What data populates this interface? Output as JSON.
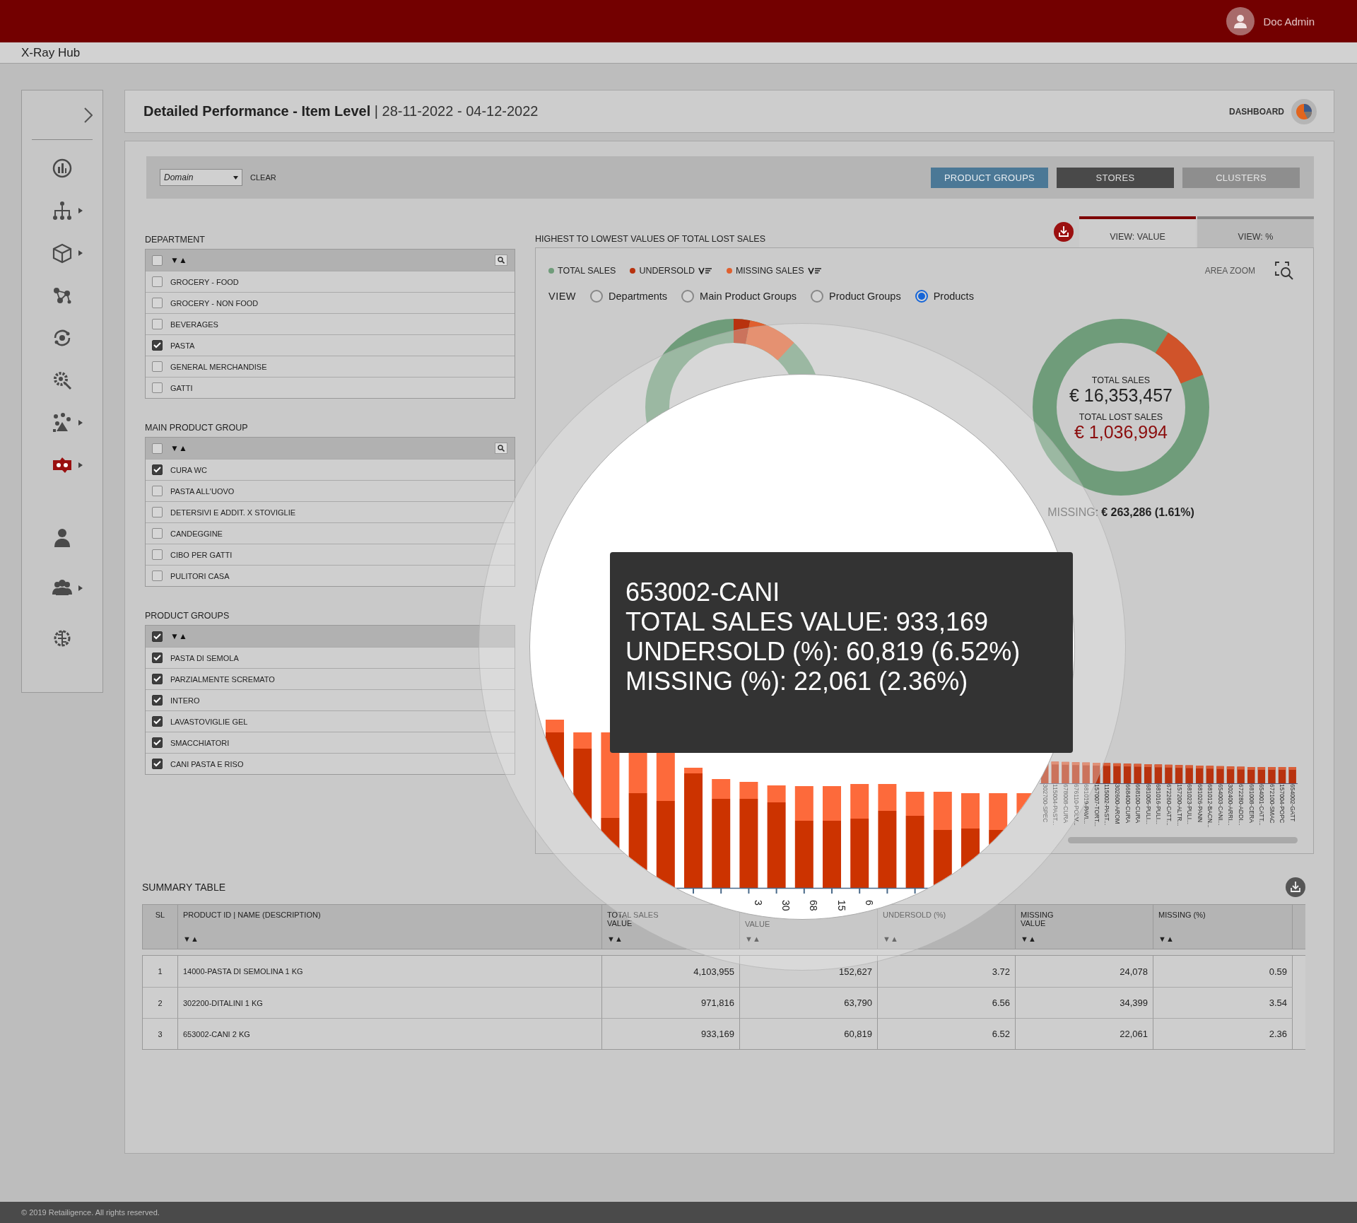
{
  "topbar": {
    "user_name": "Doc Admin"
  },
  "app_title": "X-Ray Hub",
  "sidebar": {
    "sections": [
      {
        "items": [
          {
            "kind": "gauge",
            "has_submenu": false,
            "selected": false
          },
          {
            "kind": "hierarchy",
            "has_submenu": true,
            "selected": false
          },
          {
            "kind": "cube",
            "has_submenu": true,
            "selected": false
          },
          {
            "kind": "molecule",
            "has_submenu": false,
            "selected": false
          },
          {
            "kind": "cycle",
            "has_submenu": false,
            "selected": false
          },
          {
            "kind": "gear",
            "has_submenu": false,
            "selected": false
          },
          {
            "kind": "cluster",
            "has_submenu": true,
            "selected": false
          },
          {
            "kind": "map",
            "has_submenu": true,
            "selected": true
          }
        ]
      },
      {
        "items": [
          {
            "kind": "person",
            "has_submenu": false,
            "selected": false
          },
          {
            "kind": "group",
            "has_submenu": true,
            "selected": false
          },
          {
            "kind": "brain",
            "has_submenu": false,
            "selected": false
          }
        ]
      }
    ]
  },
  "header": {
    "title": "**Detailed Performance - Item Level** | 28-11-2022 - 04-12-2022",
    "link": "DASHBOARD"
  },
  "filter_bar": {
    "domain_select": "Domain",
    "clear": "CLEAR",
    "buttons": [
      {
        "label": "PRODUCT GROUPS",
        "selected": true,
        "disabled": false
      },
      {
        "label": "STORES",
        "selected": false,
        "disabled": false
      },
      {
        "label": "CLUSTERS",
        "selected": false,
        "disabled": true
      }
    ]
  },
  "filters": [
    {
      "title": "DEPARTMENT",
      "header": {
        "checked": false,
        "sort": "▼▲",
        "searchable": true
      },
      "items": [
        {
          "label": "GROCERY - FOOD",
          "checked": false
        },
        {
          "label": "GROCERY - NON FOOD",
          "checked": false
        },
        {
          "label": "BEVERAGES",
          "checked": false
        },
        {
          "label": "PASTA",
          "checked": true
        },
        {
          "label": "GENERAL MERCHANDISE",
          "checked": false
        },
        {
          "label": "GATTI",
          "checked": false
        }
      ]
    },
    {
      "title": "MAIN PRODUCT GROUP",
      "header": {
        "checked": false,
        "sort": "▼▲",
        "searchable": true
      },
      "items": [
        {
          "label": "CURA WC",
          "checked": true
        },
        {
          "label": "PASTA ALL'UOVO",
          "checked": false
        },
        {
          "label": "DETERSIVI E ADDIT. X STOVIGLIE",
          "checked": false
        },
        {
          "label": "CANDEGGINE",
          "checked": false
        },
        {
          "label": "CIBO PER GATTI",
          "checked": false
        },
        {
          "label": "PULITORI CASA",
          "checked": false
        }
      ]
    },
    {
      "title": "PRODUCT GROUPS",
      "header": {
        "checked": true,
        "sort": "▼▲",
        "searchable": false
      },
      "items": [
        {
          "label": "PASTA DI SEMOLA",
          "checked": true
        },
        {
          "label": "PARZIALMENTE SCREMATO",
          "checked": true
        },
        {
          "label": "INTERO",
          "checked": true
        },
        {
          "label": "LAVASTOVIGLIE GEL",
          "checked": true
        },
        {
          "label": "SMACCHIATORI",
          "checked": true
        },
        {
          "label": "CANI PASTA E RISO",
          "checked": true
        }
      ]
    }
  ],
  "chart_panel": {
    "title": "HIGHEST TO LOWEST VALUES OF TOTAL LOST SALES",
    "tabs": [
      {
        "label": "VIEW: VALUE",
        "selected": true
      },
      {
        "label": "VIEW: %",
        "selected": false
      }
    ],
    "legend": [
      {
        "label": "TOTAL SALES",
        "color": "#6f9c7a",
        "has_filter": false
      },
      {
        "label": "UNDERSOLD",
        "color": "#b8320e",
        "has_filter": true
      },
      {
        "label": "MISSING SALES",
        "color": "#e0602f",
        "has_filter": true
      }
    ],
    "area_zoom": "AREA ZOOM",
    "view": {
      "label": "VIEW",
      "options": [
        {
          "label": "Departments",
          "selected": false
        },
        {
          "label": "Main Product Groups",
          "selected": false
        },
        {
          "label": "Product Groups",
          "selected": false
        },
        {
          "label": "Products",
          "selected": true
        }
      ]
    },
    "donut": {
      "total_label": "TOTAL SALES",
      "total_value": "€ 16,353,457",
      "lost_label": "TOTAL LOST SALES",
      "lost_value": "€ 1,036,994",
      "missing_label": "MISSING:",
      "missing_value": "€ 263,286 (1.61%)"
    },
    "bar_labels": [
      "302700-SPEC",
      "115004-PAST...",
      "678008-CURA",
      "676110-POLV...",
      "681019-PAVI...",
      "157007-TORT...",
      "115002-PAST...",
      "302600-AROM",
      "668400-CURA",
      "668100-CURA",
      "681005-PULI...",
      "681016-PULI...",
      "672260-CATT...",
      "157200-ALTR...",
      "681023-PULI...",
      "681026-PANN",
      "681012-BACN...",
      "654003-CANI...",
      "302400-ARRI...",
      "672280-ADDI...",
      "681008-CERA",
      "654001-CATT...",
      "672100-SMAC",
      "157004-POPC",
      "654002-GATT"
    ]
  },
  "magnifier": {
    "axis_fragments": [
      "3",
      "30",
      "68",
      "15",
      "6"
    ],
    "tooltip": [
      "653002-CANI",
      "TOTAL SALES VALUE: 933,169",
      "UNDERSOLD (%): 60,819 (6.52%)",
      "MISSING (%): 22,061 (2.36%)"
    ]
  },
  "summary": {
    "title": "SUMMARY TABLE",
    "columns": [
      {
        "lines": [
          "SL"
        ]
      },
      {
        "lines": [
          "PRODUCT ID | NAME (DESCRIPTION)"
        ],
        "sort": "▼▲"
      },
      {
        "lines": [
          "TOTAL SALES",
          "VALUE"
        ],
        "sort": "▼▲"
      },
      {
        "lines": [
          "VALUE"
        ],
        "sort": "▼▲"
      },
      {
        "lines": [
          "UNDERSOLD (%)"
        ],
        "sort": "▼▲"
      },
      {
        "lines": [
          "MISSING",
          "VALUE"
        ],
        "sort": "▼▲"
      },
      {
        "lines": [
          "MISSING (%)"
        ],
        "sort": "▼▲"
      }
    ],
    "rows": [
      [
        "1",
        "14000-PASTA DI SEMOLINA 1 KG",
        "4,103,955",
        "152,627",
        "3.72",
        "24,078",
        "0.59"
      ],
      [
        "2",
        "302200-DITALINI 1 KG",
        "971,816",
        "63,790",
        "6.56",
        "34,399",
        "3.54"
      ],
      [
        "3",
        "653002-CANI 2 KG",
        "933,169",
        "60,819",
        "6.52",
        "22,061",
        "2.36"
      ]
    ]
  },
  "footer": "© 2019 Retailigence. All rights reserved."
}
